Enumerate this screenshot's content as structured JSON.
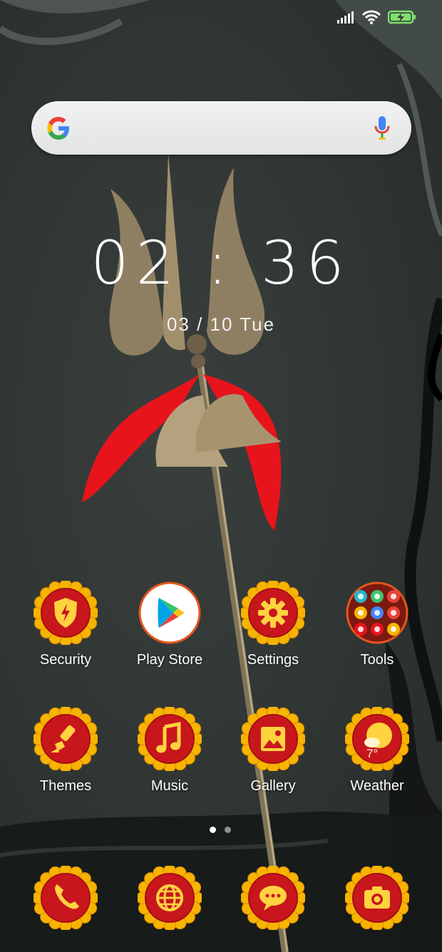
{
  "status_bar": {
    "signal": "signal-icon",
    "wifi": "wifi-icon",
    "battery": "battery-charging-icon"
  },
  "search": {
    "logo": "google-g-icon",
    "mic": "mic-icon"
  },
  "clock": {
    "time": "02 : 36",
    "date": "03 / 10  Tue"
  },
  "home_apps": [
    {
      "label": "Security",
      "icon": "shield-bolt-icon"
    },
    {
      "label": "Play Store",
      "icon": "play-store-icon"
    },
    {
      "label": "Settings",
      "icon": "gear-icon"
    },
    {
      "label": "Tools",
      "icon": "folder-icon"
    },
    {
      "label": "Themes",
      "icon": "brush-icon"
    },
    {
      "label": "Music",
      "icon": "music-note-icon"
    },
    {
      "label": "Gallery",
      "icon": "image-icon"
    },
    {
      "label": "Weather",
      "icon": "weather-icon",
      "temperature": "7°"
    }
  ],
  "pages": {
    "count": 2,
    "active": 1
  },
  "dock": [
    {
      "icon": "phone-icon"
    },
    {
      "icon": "globe-icon"
    },
    {
      "icon": "chat-bubble-icon"
    },
    {
      "icon": "camera-icon"
    }
  ],
  "colors": {
    "marigold": "#f6b400",
    "badge_red": "#c8161d",
    "ribbon_red": "#e8141c",
    "glyph_yellow": "#ffd23f"
  }
}
